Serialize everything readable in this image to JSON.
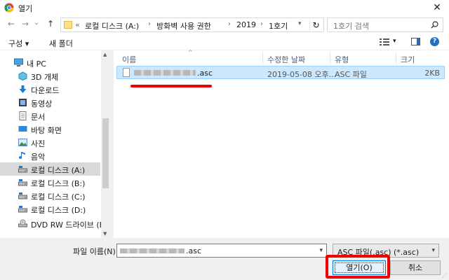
{
  "window": {
    "title": "열기",
    "close_glyph": "✕"
  },
  "nav": {
    "back_glyph": "←",
    "forward_glyph": "→",
    "recent_glyph": "⌄",
    "up_glyph": "↑",
    "address": {
      "prefix": "«",
      "crumbs": [
        "로컬 디스크 (A:)",
        "방화벽 사용 권한",
        "2019",
        "1호기"
      ],
      "separator": "›"
    },
    "refresh_glyph": "↻",
    "search_placeholder": "1호기 검색"
  },
  "toolbar": {
    "organize": "구성 ▾",
    "new_folder": "새 폴더",
    "help": "?"
  },
  "sidebar": {
    "items": [
      {
        "label": "내 PC",
        "icon": "pc-icon"
      },
      {
        "label": "3D 개체",
        "icon": "3d-objects-icon"
      },
      {
        "label": "다운로드",
        "icon": "download-icon"
      },
      {
        "label": "동영상",
        "icon": "video-icon"
      },
      {
        "label": "문서",
        "icon": "document-icon"
      },
      {
        "label": "바탕 화면",
        "icon": "desktop-icon"
      },
      {
        "label": "사진",
        "icon": "pictures-icon"
      },
      {
        "label": "음악",
        "icon": "music-icon"
      },
      {
        "label": "로컬 디스크 (A:)",
        "icon": "drive-icon",
        "selected": true
      },
      {
        "label": "로컬 디스크 (B:)",
        "icon": "drive-icon"
      },
      {
        "label": "로컬 디스크 (C:)",
        "icon": "drive-icon"
      },
      {
        "label": "로컬 디스크 (D:)",
        "icon": "drive-icon"
      },
      {
        "label": "DVD RW 드라이브 (E:)",
        "icon": "dvd-drive-icon"
      }
    ]
  },
  "columns": {
    "name": "이름",
    "modified": "수정한 날짜",
    "type": "유형",
    "size": "크기"
  },
  "files": [
    {
      "name_suffix": ".asc",
      "modified": "2019-05-08 오후...",
      "type": "ASC 파일",
      "size": "2KB"
    }
  ],
  "bottom": {
    "filename_label": "파일 이름(N):",
    "filename_value": ".asc",
    "filetype_value": "ASC 파일(.asc) (*.asc)",
    "open_label": "열기(O)",
    "cancel_label": "취소"
  },
  "colors": {
    "highlight_red": "#e00000",
    "selection": "#cce8ff",
    "accent": "#0078d7"
  }
}
